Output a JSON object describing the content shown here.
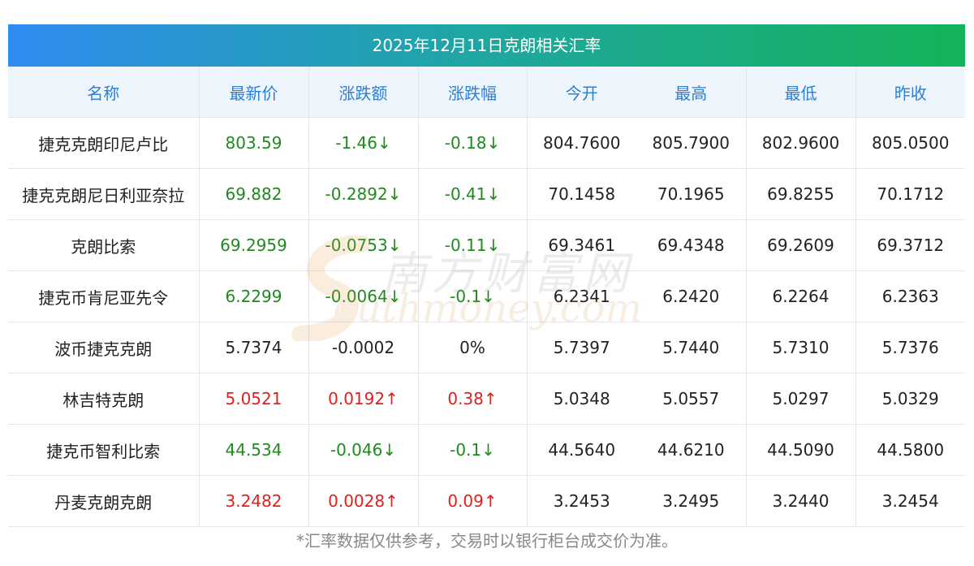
{
  "title": "2025年12月11日克朗相关汇率",
  "columns": [
    "名称",
    "最新价",
    "涨跌额",
    "涨跌幅",
    "今开",
    "最高",
    "最低",
    "昨收"
  ],
  "rows": [
    {
      "name": "捷克克朗印尼卢比",
      "latest": "803.59",
      "change": "-1.46↓",
      "pct": "-0.18↓",
      "open": "804.7600",
      "high": "805.7900",
      "low": "802.9600",
      "prev": "805.0500",
      "dir": "down"
    },
    {
      "name": "捷克克朗尼日利亚奈拉",
      "latest": "69.882",
      "change": "-0.2892↓",
      "pct": "-0.41↓",
      "open": "70.1458",
      "high": "70.1965",
      "low": "69.8255",
      "prev": "70.1712",
      "dir": "down"
    },
    {
      "name": "克朗比索",
      "latest": "69.2959",
      "change": "-0.0753↓",
      "pct": "-0.11↓",
      "open": "69.3461",
      "high": "69.4348",
      "low": "69.2609",
      "prev": "69.3712",
      "dir": "down"
    },
    {
      "name": "捷克币肯尼亚先令",
      "latest": "6.2299",
      "change": "-0.0064↓",
      "pct": "-0.1↓",
      "open": "6.2341",
      "high": "6.2420",
      "low": "6.2264",
      "prev": "6.2363",
      "dir": "down"
    },
    {
      "name": "波币捷克克朗",
      "latest": "5.7374",
      "change": "-0.0002",
      "pct": "0%",
      "open": "5.7397",
      "high": "5.7440",
      "low": "5.7310",
      "prev": "5.7376",
      "dir": "flat"
    },
    {
      "name": "林吉特克朗",
      "latest": "5.0521",
      "change": "0.0192↑",
      "pct": "0.38↑",
      "open": "5.0348",
      "high": "5.0557",
      "low": "5.0297",
      "prev": "5.0329",
      "dir": "up"
    },
    {
      "name": "捷克币智利比索",
      "latest": "44.534",
      "change": "-0.046↓",
      "pct": "-0.1↓",
      "open": "44.5640",
      "high": "44.6210",
      "low": "44.5090",
      "prev": "44.5800",
      "dir": "down"
    },
    {
      "name": "丹麦克朗克朗",
      "latest": "3.2482",
      "change": "0.0028↑",
      "pct": "0.09↑",
      "open": "3.2453",
      "high": "3.2495",
      "low": "3.2440",
      "prev": "3.2454",
      "dir": "up"
    }
  ],
  "footnote": "*汇率数据仅供参考，交易时以银行柜台成交价为准。",
  "watermark": {
    "cn": "南方财富网",
    "en": "outhmoney.com"
  },
  "colors": {
    "up": "#e0201c",
    "down": "#1f8a1f",
    "header_text": "#2a7fd6",
    "header_bg": "#eef5fd"
  }
}
